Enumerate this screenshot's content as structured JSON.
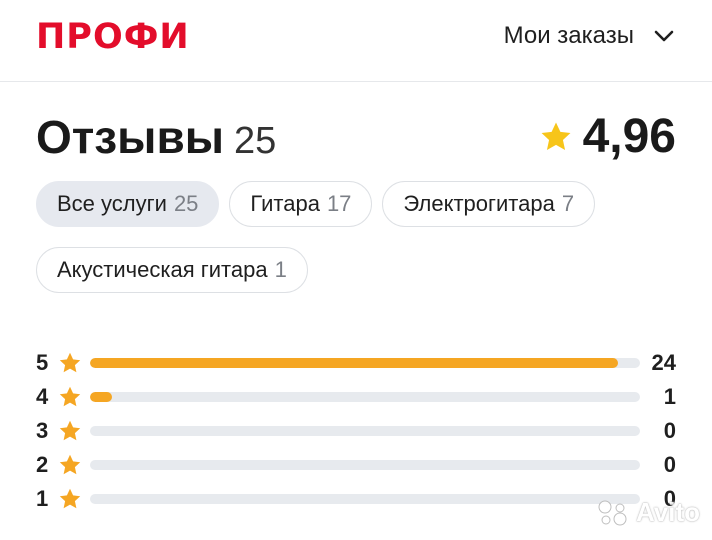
{
  "header": {
    "logo": "ПРОФИ",
    "orders_label": "Мои заказы",
    "logo_color": "#e30d2b"
  },
  "reviews": {
    "title": "Отзывы",
    "count": "25",
    "rating": "4,96"
  },
  "chips": [
    {
      "label": "Все услуги",
      "count": "25",
      "active": true
    },
    {
      "label": "Гитара",
      "count": "17",
      "active": false
    },
    {
      "label": "Электрогитара",
      "count": "7",
      "active": false
    },
    {
      "label": "Акустическая гитара",
      "count": "1",
      "active": false
    }
  ],
  "distribution": [
    {
      "stars": "5",
      "count": "24",
      "fraction": 0.96
    },
    {
      "stars": "4",
      "count": "1",
      "fraction": 0.04
    },
    {
      "stars": "3",
      "count": "0",
      "fraction": 0
    },
    {
      "stars": "2",
      "count": "0",
      "fraction": 0
    },
    {
      "stars": "1",
      "count": "0",
      "fraction": 0
    }
  ],
  "colors": {
    "accent_star": "#f5a623",
    "bar_track": "#e7eaee"
  },
  "icons": {
    "rating": "star-icon",
    "orders": "chevron-down-icon"
  },
  "watermark": "Avito"
}
